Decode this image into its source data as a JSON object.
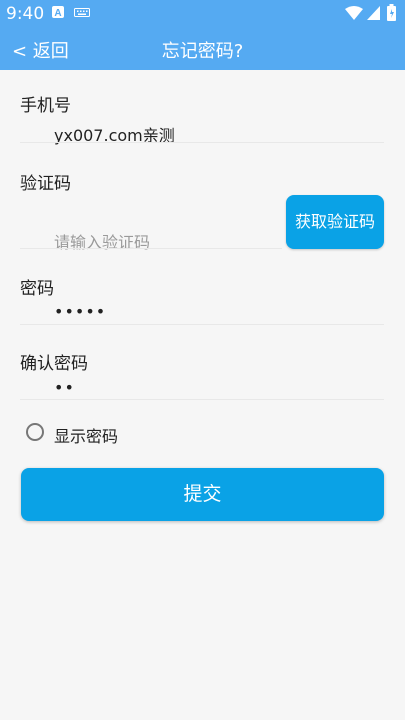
{
  "status_bar": {
    "time": "9:40",
    "icons": [
      "a-notification-icon",
      "keyboard-icon",
      "wifi-icon",
      "signal-icon",
      "battery-icon"
    ]
  },
  "header": {
    "back_label": "< 返回",
    "title": "忘记密码?"
  },
  "form": {
    "phone": {
      "label": "手机号",
      "value": "yx007.com亲测"
    },
    "code": {
      "label": "验证码",
      "placeholder": "请输入验证码",
      "button": "获取验证码"
    },
    "password": {
      "label": "密码",
      "value": "•••••"
    },
    "confirm": {
      "label": "确认密码",
      "value": "••"
    },
    "show_password": {
      "label": "显示密码",
      "checked": false
    },
    "submit": "提交"
  },
  "colors": {
    "header_bg": "#55aaf2",
    "button_bg": "#0aa2e6",
    "page_bg": "#f6f6f6"
  }
}
